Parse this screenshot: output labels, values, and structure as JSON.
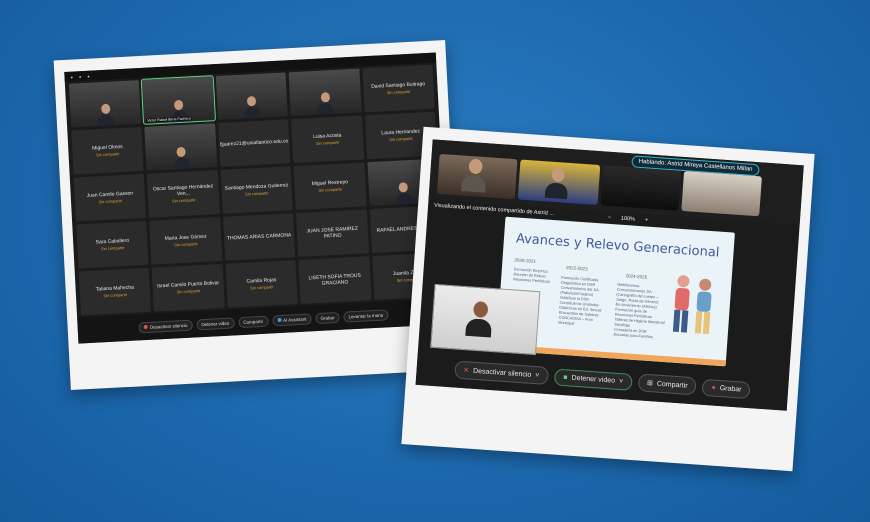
{
  "photo1": {
    "tiles": [
      {
        "name": "",
        "status": "",
        "cam": true
      },
      {
        "name": "Victor Rafael Birria Pacheco",
        "status": "",
        "cam": true,
        "active": true
      },
      {
        "name": "",
        "status": "",
        "cam": true
      },
      {
        "name": "",
        "status": "",
        "cam": true
      },
      {
        "name": "David Santiago Buitrago",
        "status": "Sin compartir"
      },
      {
        "name": "Miguel Olmos",
        "status": "Sin compartir"
      },
      {
        "name": "",
        "status": "",
        "cam": true
      },
      {
        "name": "fjjuarez21@uniatlantico.edu.co",
        "status": ""
      },
      {
        "name": "Luisa Acosta",
        "status": "Sin compartir"
      },
      {
        "name": "Laura Hernandez",
        "status": "Sin compartir"
      },
      {
        "name": "Juan Camilo Gasson",
        "status": "Sin compartir"
      },
      {
        "name": "Oscar Santiago Hernández Ven...",
        "status": "Sin compartir"
      },
      {
        "name": "Santiago Mendoza Gutierrez",
        "status": "Sin compartir"
      },
      {
        "name": "Miguel Restrepo",
        "status": "Sin compartir"
      },
      {
        "name": "",
        "status": "",
        "cam": true
      },
      {
        "name": "Sara Caballero",
        "status": "Sin compartir"
      },
      {
        "name": "Maria Jose Gómez",
        "status": "Sin compartir"
      },
      {
        "name": "THOMAS ARIAS CARMONA",
        "status": ""
      },
      {
        "name": "JUAN JOSE RAMIREZ PATINO",
        "status": ""
      },
      {
        "name": "RAFAEL ANDRES RUBI...",
        "status": ""
      },
      {
        "name": "Tatiana Mahecha",
        "status": "Sin compartir"
      },
      {
        "name": "Israel Camilo Puerto Bolivar",
        "status": "Sin compartir"
      },
      {
        "name": "Camila Rojas",
        "status": "Sin compartir"
      },
      {
        "name": "LISETH SOFIA TROUS GRACIANO",
        "status": ""
      },
      {
        "name": "Juanita Zap...",
        "status": "Sin compartir"
      }
    ],
    "bar": [
      "Desactivar silencio",
      "Detener video",
      "Compartir",
      "AI Assistant",
      "Grabar",
      "Levantar la mano"
    ]
  },
  "photo2": {
    "speaking": "Hablando: Astrid Mireya Castellanos Millan",
    "share_label": "Visualizando el contenido compartido de Astrid ...",
    "zoom": "100%",
    "slide_title": "Avances y Relevo Generacional",
    "years": [
      "2020-2021",
      "2022-2023",
      "2024-2025"
    ],
    "col1": "Formación Empírica\nReunión de Relevo\nReuniones Periódicas",
    "col2": "Formación Certificada\nDiagnóstico en DSR\nConversatorios del JIA\n(Fabulista/Creativo)\nVisibilizar la DSR\nConstituimos Unidades\nDidácticas en Ed. Sexual\nEncuentros de Saberes\nCONCADISA – Foro\nMunicipal",
    "col3": "Visibilizamos:\nConcentraciones JIA\n(Cartografía del cuerpo –\nJuego, Rutas de Género)\nEn Movimiento (Afiches)\nFormación guía de\nReuniones Periódicas\nTalleres de Higiene Menstrual\nSexóloga\nConsejería en DSR\nEscuelas para Familias",
    "buttons": [
      "Desactivar silencio",
      "Detener video",
      "Compartir",
      "Grabar"
    ]
  }
}
